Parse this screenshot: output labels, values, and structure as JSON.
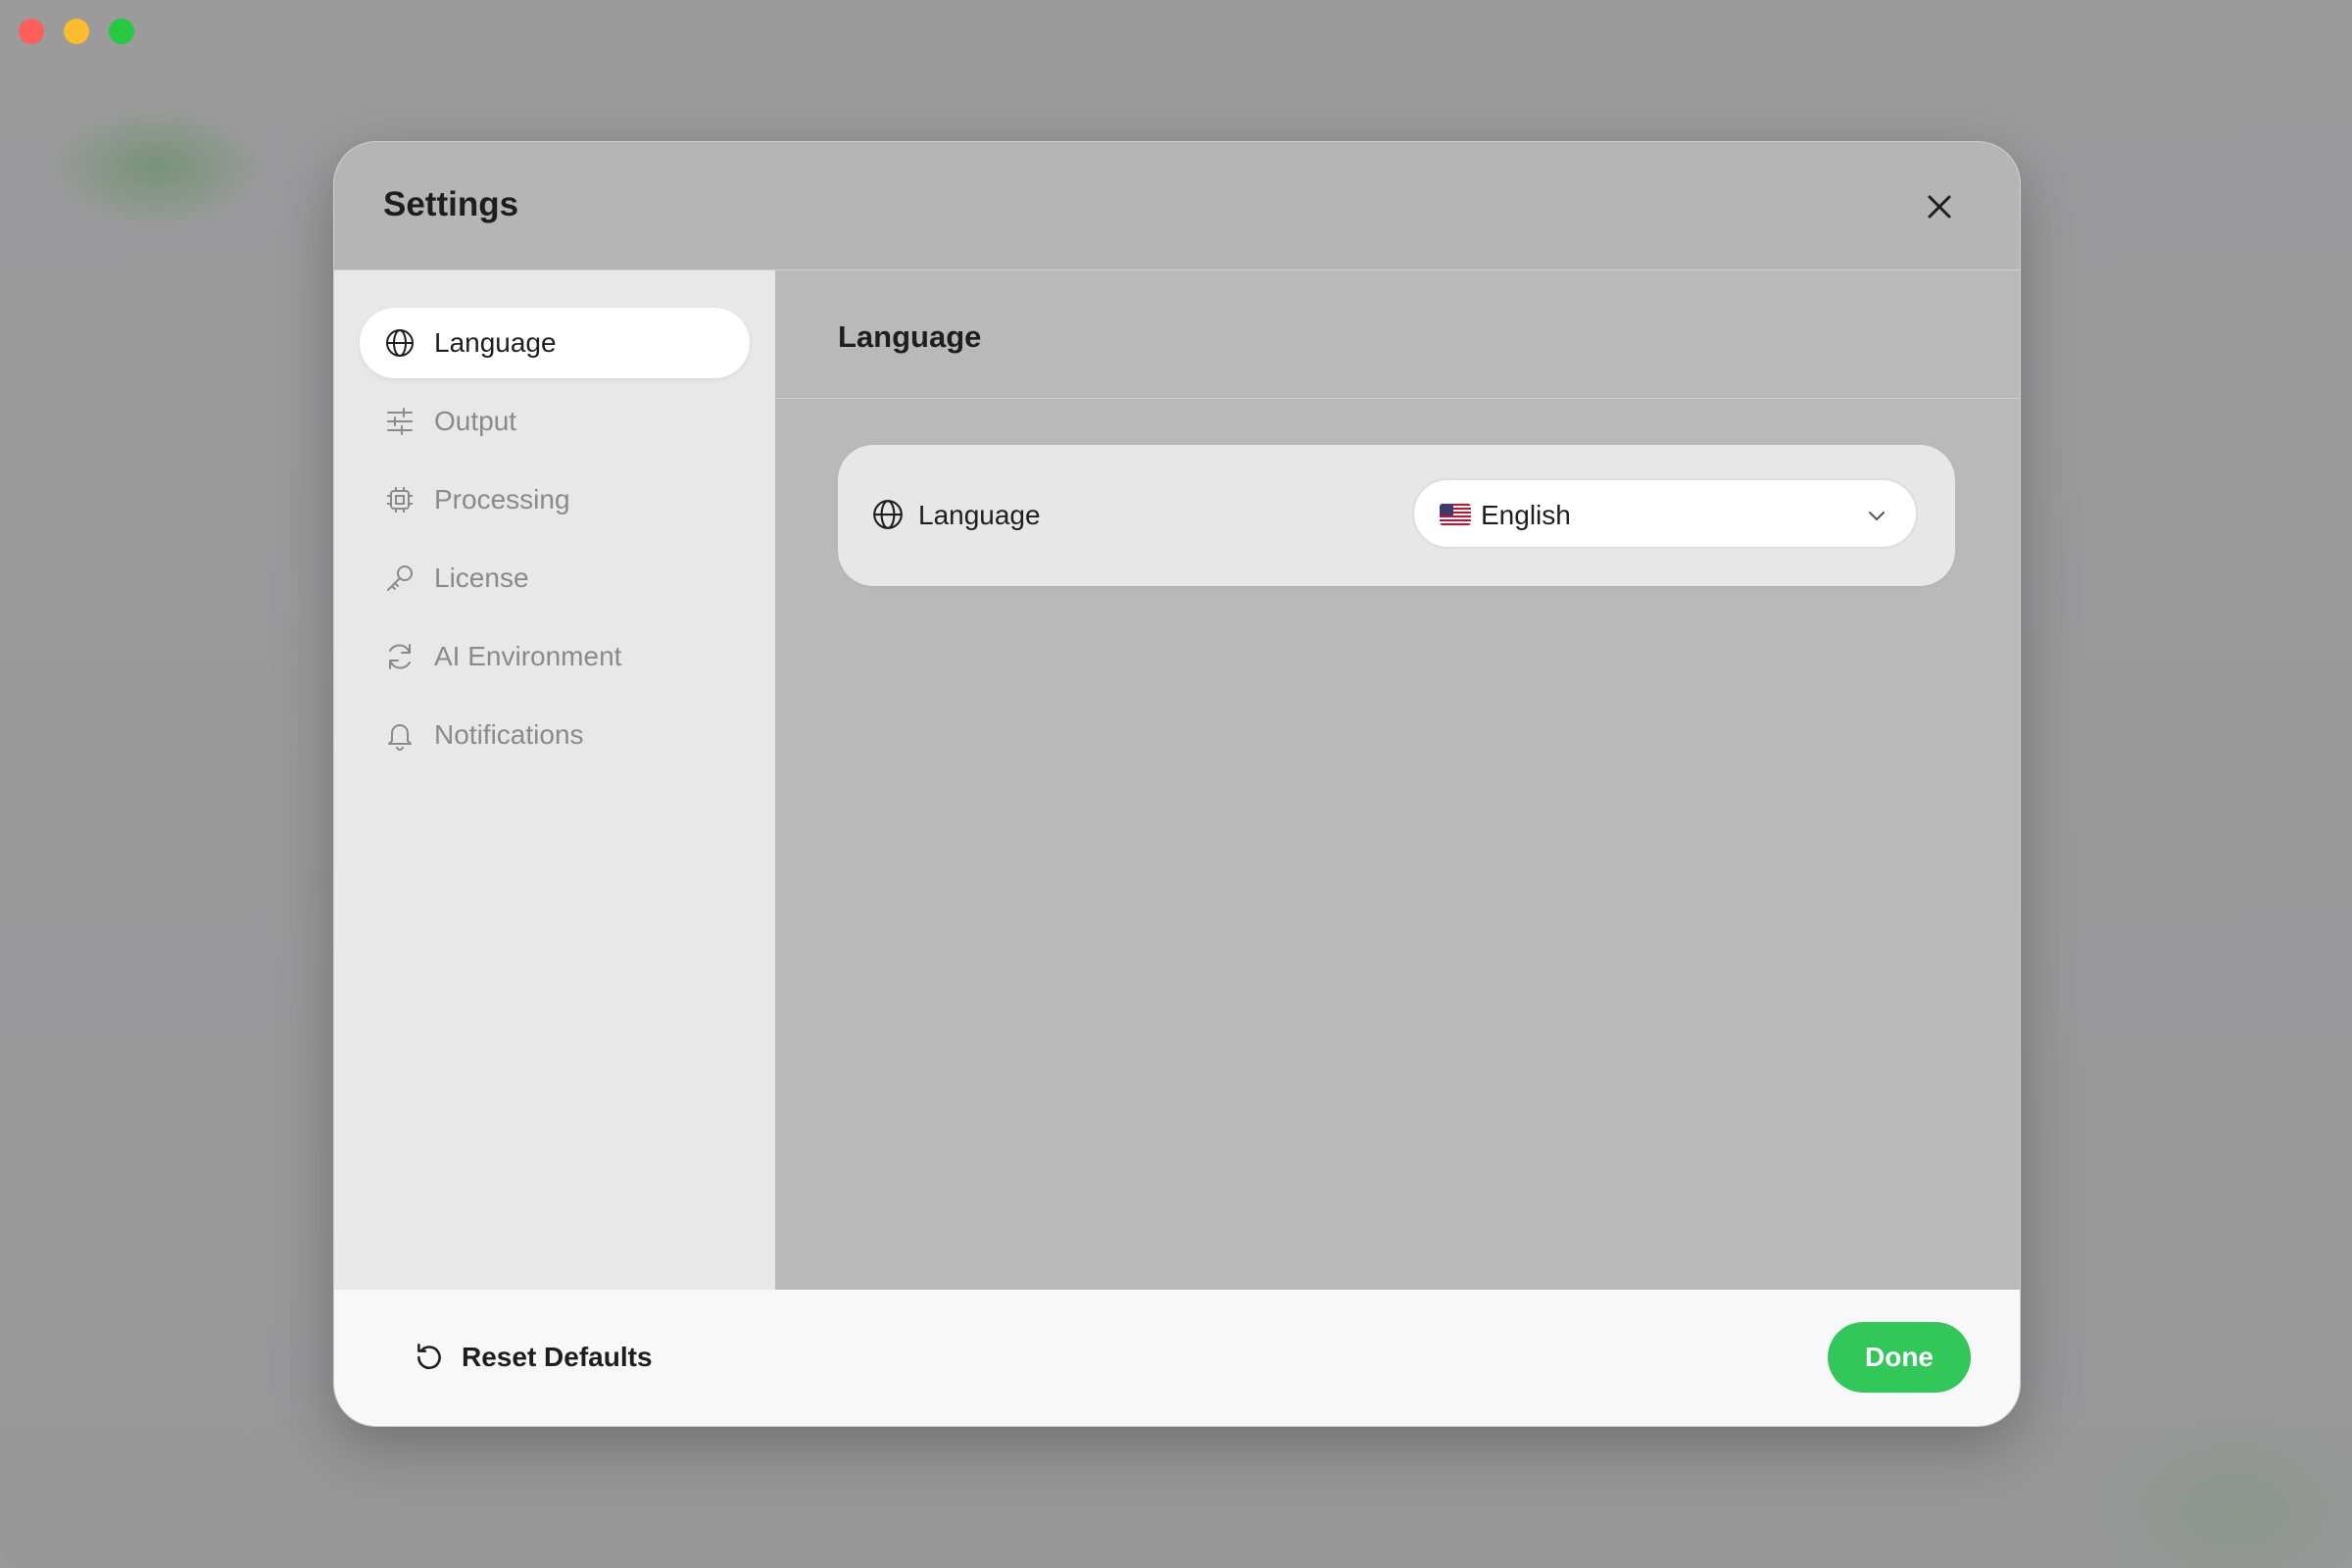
{
  "window": {
    "traffic_lights": [
      "close",
      "minimize",
      "maximize"
    ]
  },
  "dialog": {
    "title": "Settings",
    "close_icon": "close-icon"
  },
  "sidebar": {
    "items": [
      {
        "label": "Language",
        "icon": "globe-icon",
        "active": true
      },
      {
        "label": "Output",
        "icon": "sliders-icon",
        "active": false
      },
      {
        "label": "Processing",
        "icon": "cpu-icon",
        "active": false
      },
      {
        "label": "License",
        "icon": "key-icon",
        "active": false
      },
      {
        "label": "AI Environment",
        "icon": "refresh-icon",
        "active": false
      },
      {
        "label": "Notifications",
        "icon": "bell-icon",
        "active": false
      }
    ]
  },
  "content": {
    "title": "Language",
    "language_row": {
      "label": "Language",
      "icon": "globe-icon",
      "selected_value": "English",
      "flag": "us-flag-icon"
    }
  },
  "footer": {
    "reset_label": "Reset Defaults",
    "done_label": "Done"
  },
  "colors": {
    "accent_green": "#32c759",
    "traffic_red": "#fe5f57",
    "traffic_yellow": "#febc2e",
    "traffic_green": "#28c840"
  }
}
